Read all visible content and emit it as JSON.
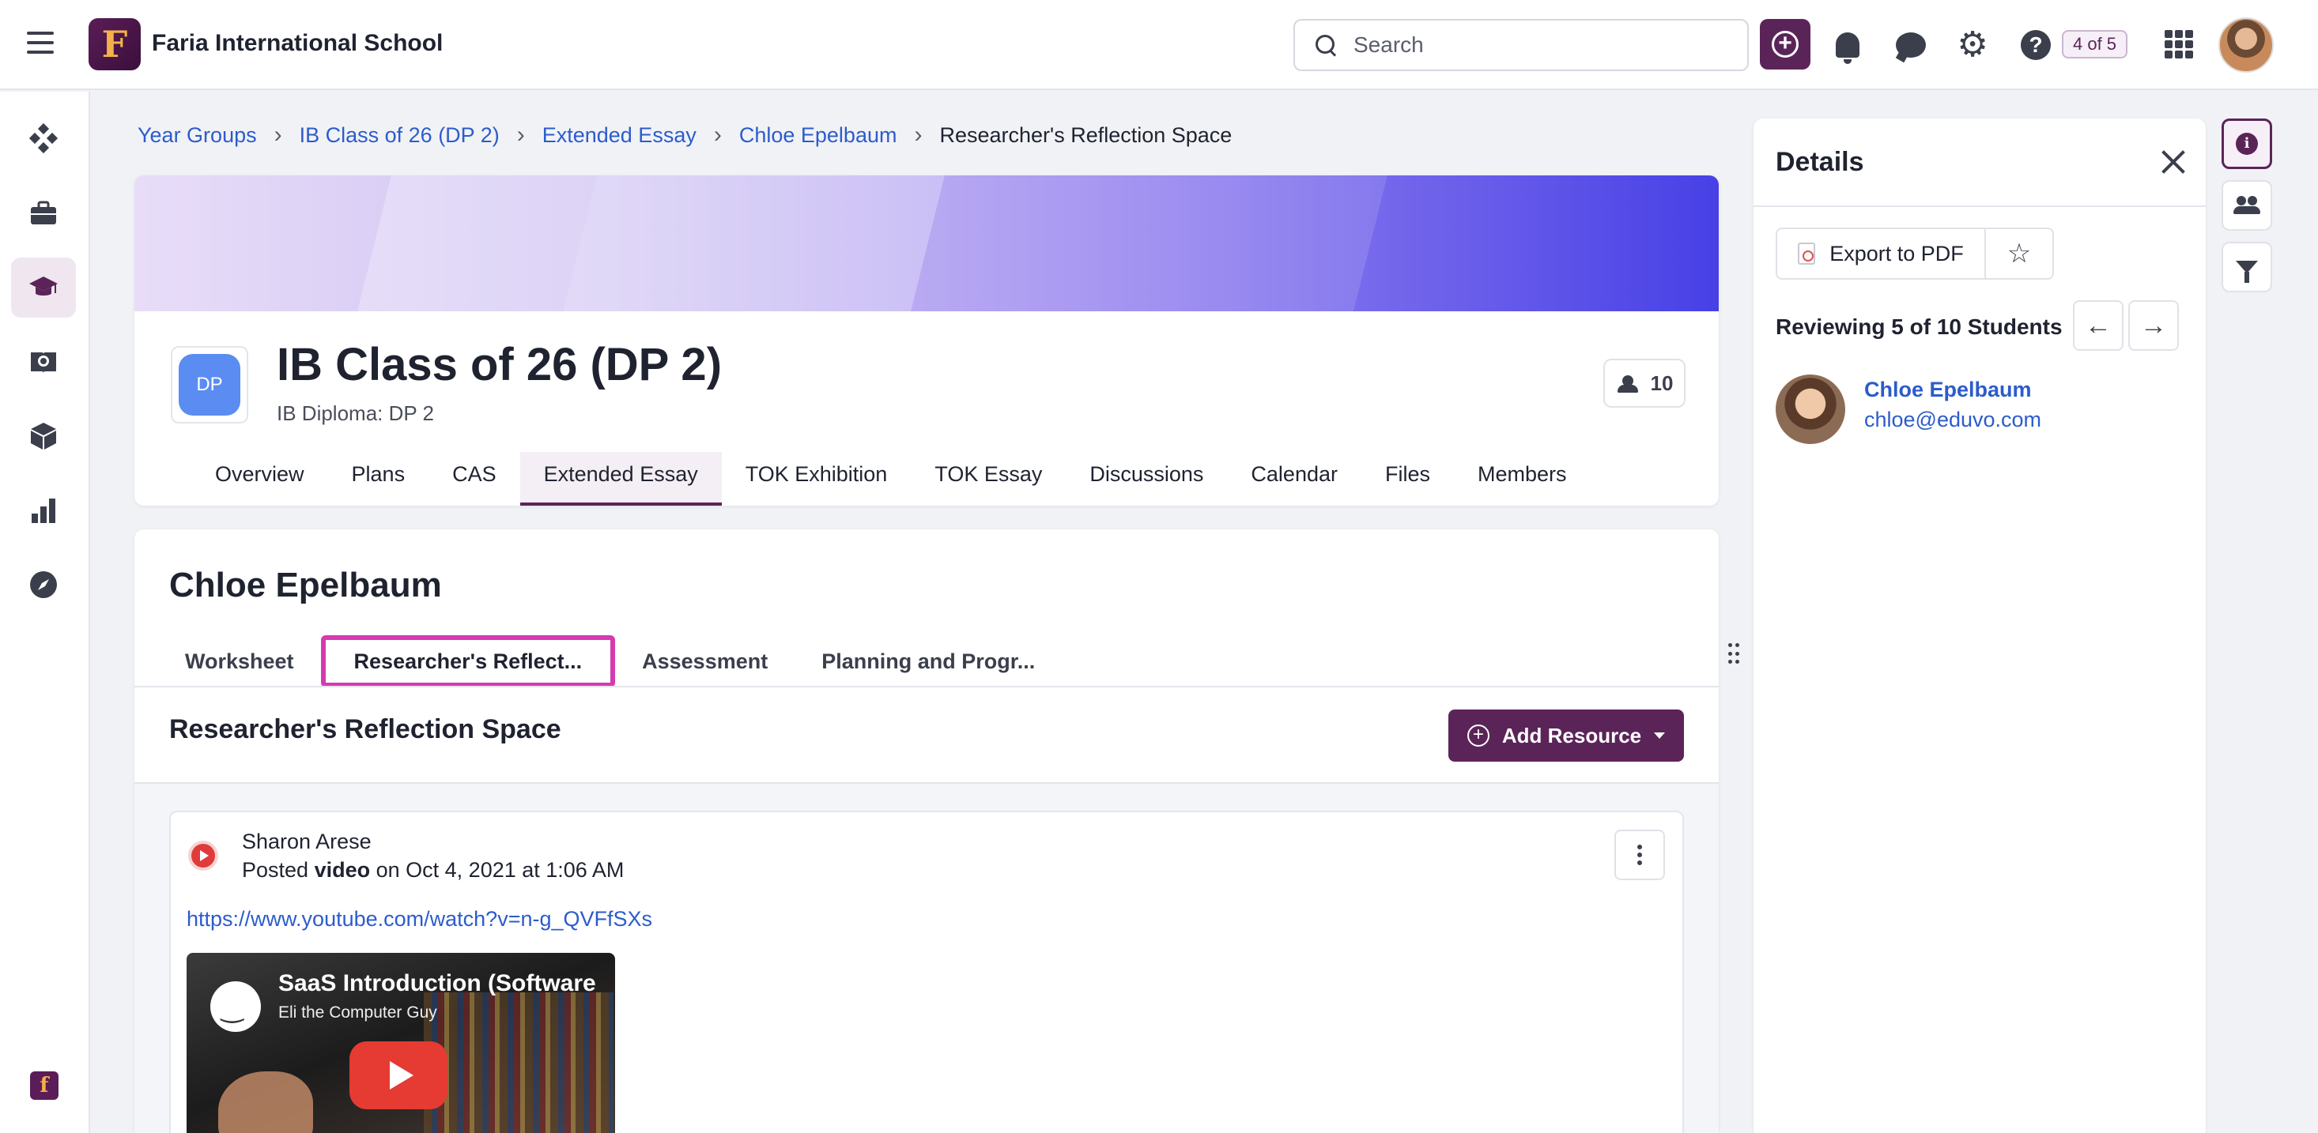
{
  "header": {
    "school_name": "Faria International School",
    "logo_letter": "F",
    "search_placeholder": "Search",
    "counter_badge": "4 of 5"
  },
  "left_nav": {
    "items": [
      {
        "name": "dashboard",
        "icon": "diamond-grid-icon"
      },
      {
        "name": "briefcase",
        "icon": "briefcase-icon"
      },
      {
        "name": "classes",
        "icon": "graduation-cap-icon",
        "active": true
      },
      {
        "name": "library",
        "icon": "book-globe-icon"
      },
      {
        "name": "resources",
        "icon": "cube-icon"
      },
      {
        "name": "reports",
        "icon": "bar-chart-icon"
      },
      {
        "name": "explore",
        "icon": "compass-icon"
      }
    ],
    "bottom_logo_letter": "f"
  },
  "breadcrumb": {
    "items": [
      "Year Groups",
      "IB Class of 26 (DP 2)",
      "Extended Essay",
      "Chloe Epelbaum"
    ],
    "current": "Researcher's Reflection Space"
  },
  "class_card": {
    "icon_text": "DP",
    "title": "IB Class of 26 (DP 2)",
    "subtitle": "IB Diploma: DP 2",
    "members_count": "10",
    "tabs": [
      "Overview",
      "Plans",
      "CAS",
      "Extended Essay",
      "TOK Exhibition",
      "TOK Essay",
      "Discussions",
      "Calendar",
      "Files",
      "Members"
    ],
    "active_tab": "Extended Essay"
  },
  "student_card": {
    "name": "Chloe Epelbaum",
    "tabs": [
      "Worksheet",
      "Researcher's Reflect...",
      "Assessment",
      "Planning and Progr..."
    ],
    "active_tab": "Researcher's Reflect...",
    "section_title": "Researcher's Reflection Space",
    "add_resource_label": "Add Resource"
  },
  "post": {
    "author": "Sharon Arese",
    "meta_prefix": "Posted",
    "meta_type": "video",
    "meta_suffix": "on Oct 4, 2021 at 1:06 AM",
    "link": "https://www.youtube.com/watch?v=n-g_QVFfSXs",
    "video_title": "SaaS Introduction (Software",
    "video_channel": "Eli the Computer Guy"
  },
  "details": {
    "title": "Details",
    "export_label": "Export to PDF",
    "reviewing": "Reviewing 5 of 10 Students",
    "student_name": "Chloe Epelbaum",
    "student_email": "chloe@eduvo.com"
  },
  "colors": {
    "brand": "#5b2458",
    "link": "#2c5ccb",
    "highlight": "#d63ab1"
  }
}
